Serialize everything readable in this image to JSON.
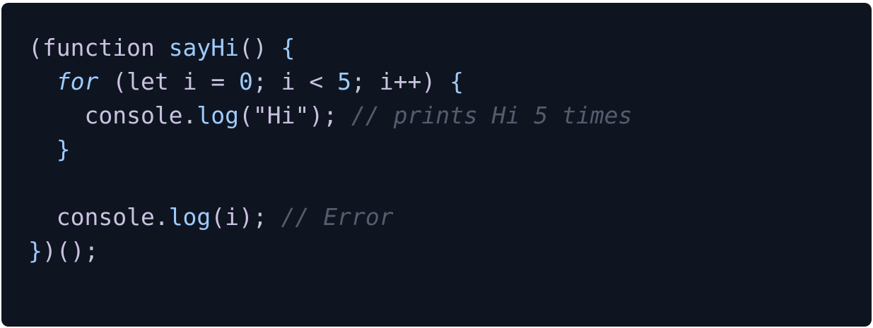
{
  "code": {
    "lines": [
      [
        {
          "t": "(function ",
          "c": "plain"
        },
        {
          "t": "sayHi",
          "c": "blue"
        },
        {
          "t": "() ",
          "c": "plain"
        },
        {
          "t": "{",
          "c": "blue"
        }
      ],
      [
        {
          "t": "  ",
          "c": "plain"
        },
        {
          "t": "for",
          "c": "kw-italic"
        },
        {
          "t": " (let i = ",
          "c": "plain"
        },
        {
          "t": "0",
          "c": "blue"
        },
        {
          "t": "; i < ",
          "c": "plain"
        },
        {
          "t": "5",
          "c": "blue"
        },
        {
          "t": "; i++) ",
          "c": "plain"
        },
        {
          "t": "{",
          "c": "blue"
        }
      ],
      [
        {
          "t": "    console.",
          "c": "plain"
        },
        {
          "t": "log",
          "c": "blue"
        },
        {
          "t": "(\"Hi\"); ",
          "c": "plain"
        },
        {
          "t": "// prints Hi 5 times",
          "c": "comment"
        }
      ],
      [
        {
          "t": "  ",
          "c": "plain"
        },
        {
          "t": "}",
          "c": "blue"
        }
      ],
      [],
      [
        {
          "t": "  console.",
          "c": "plain"
        },
        {
          "t": "log",
          "c": "blue"
        },
        {
          "t": "(i); ",
          "c": "plain"
        },
        {
          "t": "// Error",
          "c": "comment"
        }
      ],
      [
        {
          "t": "}",
          "c": "blue"
        },
        {
          "t": ")();",
          "c": "plain"
        }
      ]
    ]
  },
  "colors": {
    "background": "#0f1520",
    "keyword": "#9ecbff",
    "text": "#c9c2e0",
    "comment": "#545c6e"
  }
}
